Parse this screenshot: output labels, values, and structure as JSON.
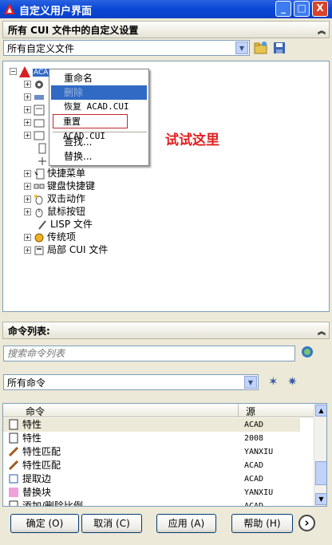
{
  "window": {
    "title": "自定义用户界面",
    "min": "_",
    "max": "□",
    "close": "X"
  },
  "section1": {
    "title": "所有 CUI 文件中的自定义设置",
    "chevron": "︽",
    "file_select": "所有自定义文件"
  },
  "tree": {
    "root": "ACAD",
    "items": [
      "快捷菜单",
      "键盘快捷键",
      "双击动作",
      "鼠标按钮",
      "LISP 文件",
      "传统项",
      "局部 CUI 文件"
    ]
  },
  "context_menu": {
    "items": [
      "重命名",
      "删除",
      "恢复 ACAD.CUI",
      "重置 ACAD.CUI",
      "查找...",
      "替换..."
    ]
  },
  "annotation": "试试这里",
  "section2": {
    "title": "命令列表:",
    "chevron": "︽",
    "search_placeholder": "搜索命令列表",
    "filter_select": "所有命令"
  },
  "table": {
    "headers": [
      "命令",
      "源"
    ],
    "rows": [
      {
        "name": "特性",
        "source": "ACAD"
      },
      {
        "name": "特性",
        "source": "2008"
      },
      {
        "name": "特性匹配",
        "source": "YANXIU"
      },
      {
        "name": "特性匹配",
        "source": "ACAD"
      },
      {
        "name": "提取边",
        "source": "ACAD"
      },
      {
        "name": "替换块",
        "source": "YANXIU"
      },
      {
        "name": "添加/删除比例",
        "source": "ACAD"
      }
    ]
  },
  "buttons": {
    "ok": "确定 (O)",
    "cancel": "取消 (C)",
    "apply": "应用 (A)",
    "help": "帮助 (H)",
    "more": "›"
  }
}
